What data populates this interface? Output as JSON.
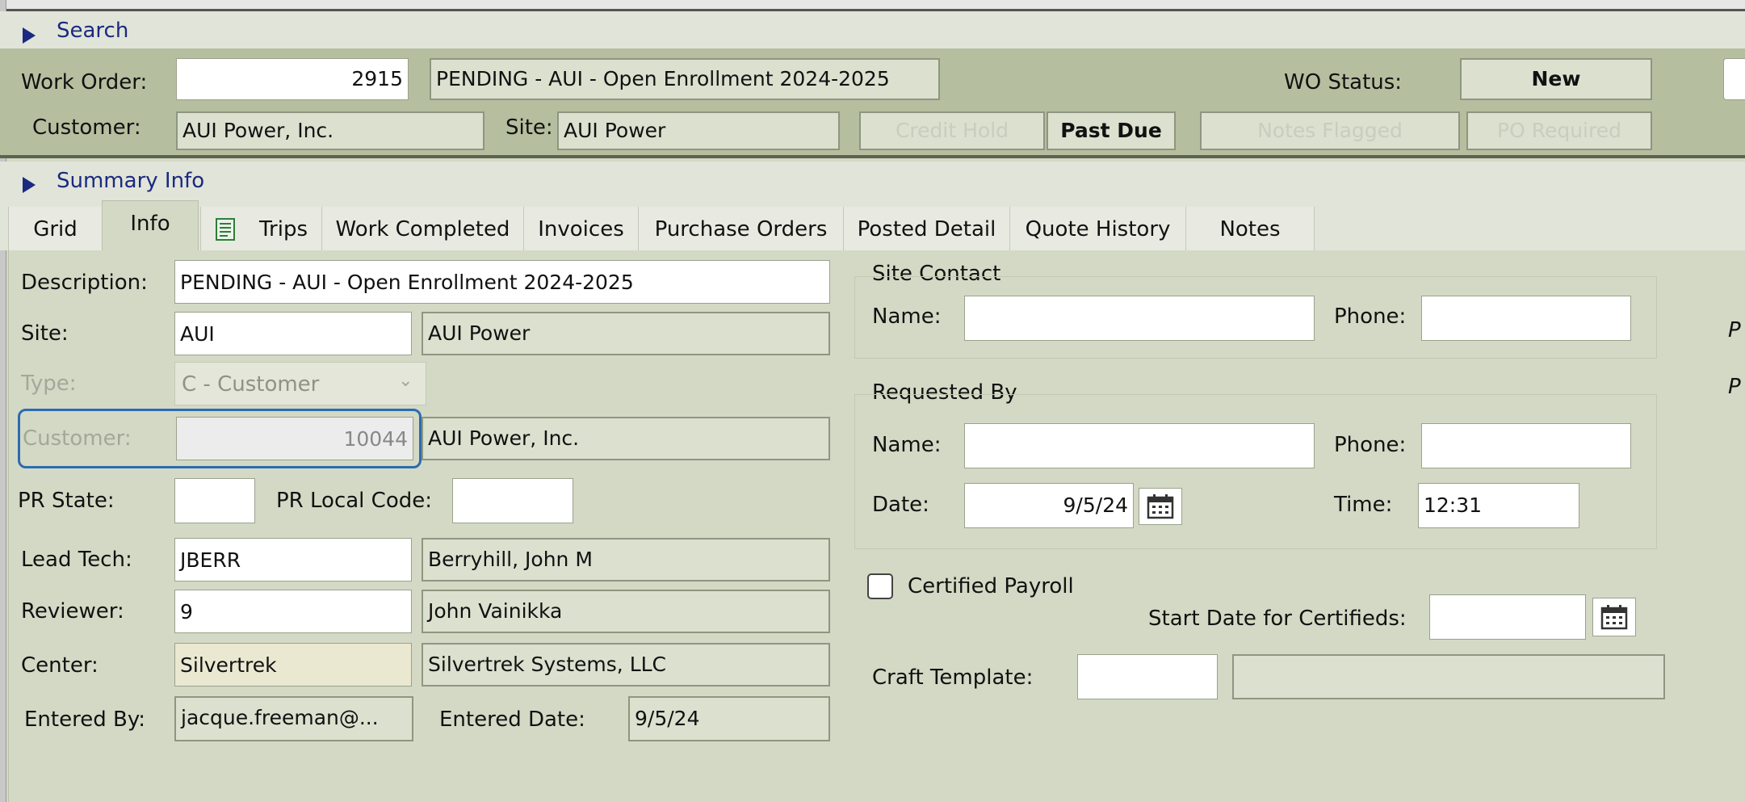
{
  "search": {
    "label": "Search"
  },
  "header": {
    "work_order_label": "Work Order:",
    "work_order_number": "2915",
    "work_order_desc": "PENDING -  AUI - Open Enrollment 2024-2025",
    "wo_status_label": "WO Status:",
    "wo_status_value": "New",
    "customer_label": "Customer:",
    "customer_value": "AUI Power, Inc.",
    "site_label": "Site:",
    "site_value": "AUI Power",
    "credit_hold": "Credit Hold",
    "past_due": "Past Due",
    "notes_flag": "Notes Flagged",
    "po_required": "PO Required"
  },
  "summary": {
    "label": "Summary Info"
  },
  "tabs": [
    "Grid",
    "Info",
    "Trips",
    "Work Completed",
    "Invoices",
    "Purchase Orders",
    "Posted Detail",
    "Quote History",
    "Notes"
  ],
  "info": {
    "description_label": "Description:",
    "description_value": "PENDING -  AUI - Open Enrollment 2024-2025",
    "site_label": "Site:",
    "site_code": "AUI",
    "site_name": "AUI Power",
    "type_label": "Type:",
    "type_value": "C - Customer",
    "customer_label": "Customer:",
    "customer_number": "10044",
    "customer_name": "AUI Power, Inc.",
    "pr_state_label": "PR State:",
    "pr_state_value": "",
    "pr_local_label": "PR Local Code:",
    "pr_local_value": "",
    "lead_tech_label": "Lead Tech:",
    "lead_tech_code": "JBERR",
    "lead_tech_name": "Berryhill, John M",
    "reviewer_label": "Reviewer:",
    "reviewer_code": "9",
    "reviewer_name": "John Vainikka",
    "center_label": "Center:",
    "center_code": "Silvertrek",
    "center_name": "Silvertrek Systems, LLC",
    "entered_by_label": "Entered By:",
    "entered_by_value": "jacque.freeman@...",
    "entered_date_label": "Entered Date:",
    "entered_date_value": "9/5/24"
  },
  "site_contact": {
    "title": "Site Contact",
    "name_label": "Name:",
    "name_value": "",
    "phone_label": "Phone:",
    "phone_value": ""
  },
  "requested_by": {
    "title": "Requested By",
    "name_label": "Name:",
    "name_value": "",
    "phone_label": "Phone:",
    "phone_value": "",
    "date_label": "Date:",
    "date_value": "9/5/24",
    "time_label": "Time:",
    "time_value": "12:31"
  },
  "payroll": {
    "certified_label": "Certified Payroll",
    "certified_checked": false,
    "start_date_label": "Start Date for Certifieds:",
    "start_date_value": "",
    "craft_label": "Craft Template:",
    "craft_code": "",
    "craft_name": ""
  },
  "edge": {
    "glyph1": "P",
    "glyph2": "P"
  },
  "colors": {
    "panel_bg": "#d4d9c5",
    "header_bg": "#b5be9e",
    "focus_border": "#2b6cb0",
    "tri": "#1a2a80"
  },
  "icons": {
    "calendar": "calendar-icon",
    "trips": "document-icon",
    "expand": "triangle-right-icon"
  }
}
